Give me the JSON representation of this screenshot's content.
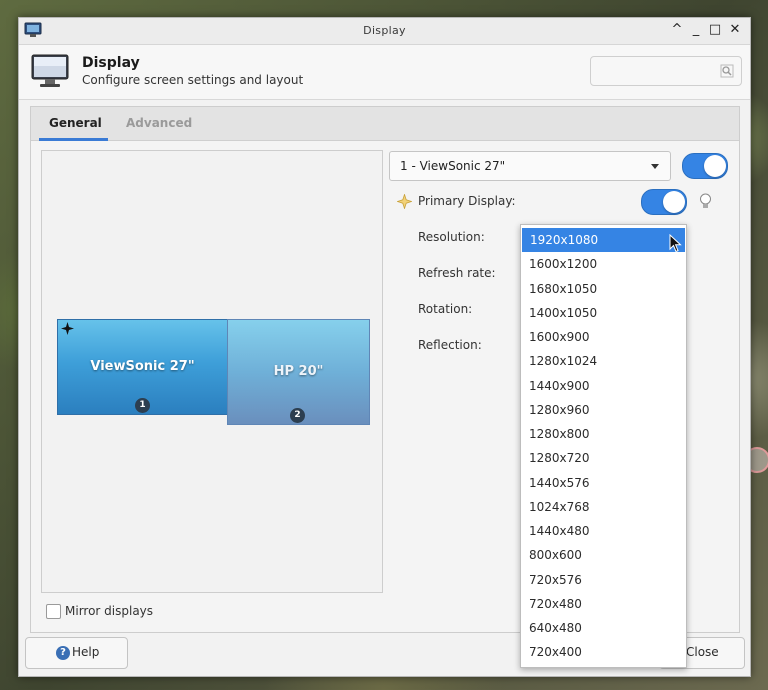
{
  "window": {
    "title": "Display",
    "controls": {
      "minimize_up": "^",
      "minimize": "_",
      "maximize": "□",
      "close": "✕"
    }
  },
  "header": {
    "title": "Display",
    "subtitle": "Configure screen settings and layout",
    "search_placeholder": ""
  },
  "tabs": [
    {
      "label": "General",
      "active": true
    },
    {
      "label": "Advanced",
      "active": false
    }
  ],
  "preview": {
    "monitors": [
      {
        "name": "ViewSonic 27\"",
        "number": "1",
        "primary": true
      },
      {
        "name": "HP 20\"",
        "number": "2",
        "primary": false
      }
    ],
    "mirror_label": "Mirror displays",
    "mirror_checked": false
  },
  "settings": {
    "selected_display": "1 - ViewSonic 27\"",
    "display_enabled": true,
    "primary_label": "Primary Display:",
    "primary_enabled": true,
    "resolution_label": "Resolution:",
    "refresh_label": "Refresh rate:",
    "rotation_label": "Rotation:",
    "reflection_label": "Reflection:"
  },
  "resolution_dropdown": {
    "selected": "1920x1080",
    "options": [
      "1920x1080",
      "1600x1200",
      "1680x1050",
      "1400x1050",
      "1600x900",
      "1280x1024",
      "1440x900",
      "1280x960",
      "1280x800",
      "1280x720",
      "1440x576",
      "1024x768",
      "1440x480",
      "800x600",
      "720x576",
      "720x480",
      "640x480",
      "720x400"
    ]
  },
  "buttons": {
    "help": "Help",
    "close": "Close"
  },
  "colors": {
    "accent": "#3584e4",
    "monitor_primary": "#3e9fd9",
    "monitor_secondary": "#6fb0d8"
  }
}
